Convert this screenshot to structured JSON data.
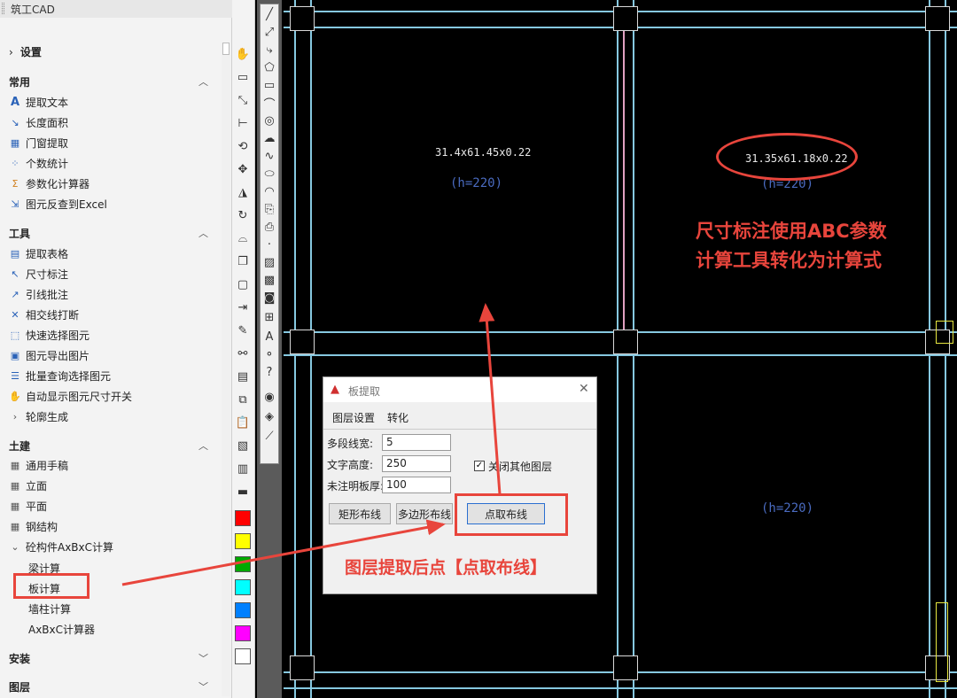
{
  "app": {
    "title": "筑工CAD"
  },
  "panel": {
    "settings": "设置",
    "sections": {
      "common": "常用",
      "tools": "工具",
      "civil": "土建",
      "install": "安装",
      "layers": "图层"
    },
    "common_items": [
      "提取文本",
      "长度面积",
      "门窗提取",
      "个数统计",
      "参数化计算器",
      "图元反查到Excel"
    ],
    "tool_items": [
      "提取表格",
      "尺寸标注",
      "引线批注",
      "相交线打断",
      "快速选择图元",
      "图元导出图片",
      "批量查询选择图元",
      "自动显示图元尺寸开关"
    ],
    "tool_more": "轮廓生成",
    "civil_items": [
      "通用手稿",
      "立面",
      "平面",
      "钢结构"
    ],
    "civil_group": "砼构件AxBxC计算",
    "civil_sub": [
      "梁计算",
      "板计算",
      "墙柱计算",
      "AxBxC计算器"
    ]
  },
  "colors": [
    "#ff0000",
    "#ffff00",
    "#00aa00",
    "#00ffff",
    "#0080ff",
    "#ff00ff",
    "#ffffff"
  ],
  "cad": {
    "dim1": "31.4x61.45x0.22",
    "dim2": "31.35x61.18x0.22",
    "h1": "(h=220)",
    "h2": "(h=220)",
    "h3": "(h=220)"
  },
  "dialog": {
    "title": "板提取",
    "tab1": "图层设置",
    "tab2": "转化",
    "label_width": "多段线宽:",
    "val_width": "5",
    "label_text_height": "文字高度:",
    "val_text_height": "250",
    "label_thickness": "未注明板厚:",
    "val_thickness": "100",
    "checkbox_label": "关闭其他图层",
    "btn_rect": "矩形布线",
    "btn_poly": "多边形布线",
    "btn_point": "点取布线"
  },
  "annotations": {
    "top_line1": "尺寸标注使用ABC参数",
    "top_line2": "计算工具转化为计算式",
    "bottom": "图层提取后点【点取布线】"
  }
}
